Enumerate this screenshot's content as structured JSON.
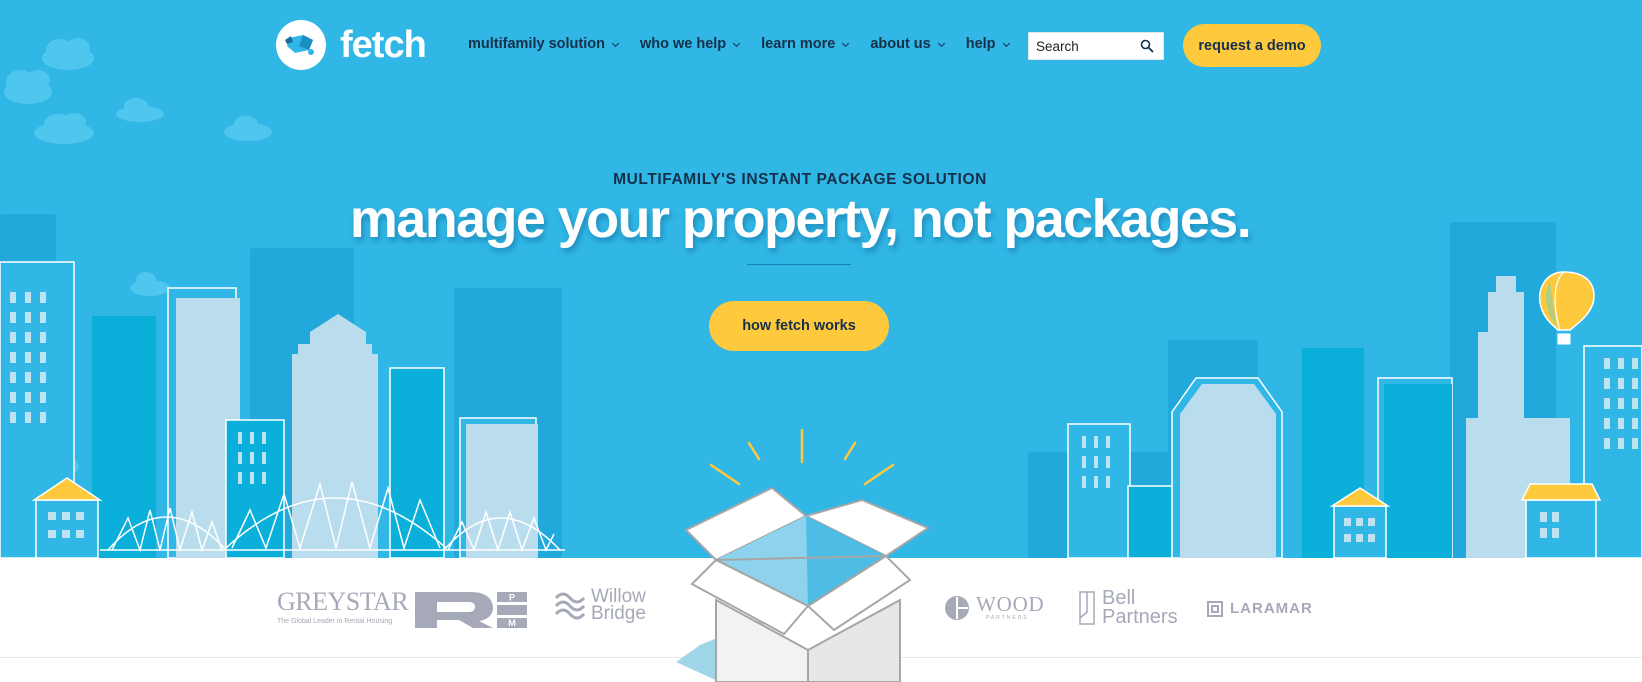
{
  "brand": {
    "name": "fetch",
    "logo_icon": "dog-package-icon"
  },
  "nav": {
    "items": [
      {
        "label": "multifamily solution"
      },
      {
        "label": "who we help"
      },
      {
        "label": "learn more"
      },
      {
        "label": "about us"
      },
      {
        "label": "help"
      }
    ]
  },
  "search": {
    "placeholder": "Search",
    "icon": "search-icon"
  },
  "header": {
    "demo_label": "request a demo"
  },
  "hero": {
    "eyebrow": "MULTIFAMILY'S INSTANT PACKAGE SOLUTION",
    "headline": "manage your property, not packages.",
    "cta_label": "how fetch works"
  },
  "partners": {
    "greystar": {
      "name": "GREYSTAR",
      "tagline": "The Global Leader in Rental Housing"
    },
    "rpm": {
      "name": "RPM"
    },
    "willow": {
      "line1": "Willow",
      "line2": "Bridge"
    },
    "wood": {
      "name": "WOOD",
      "sub": "PARTNERS"
    },
    "bell": {
      "line1": "Bell",
      "line2": "Partners"
    },
    "laramar": {
      "name": "LARAMAR"
    }
  },
  "colors": {
    "sky": "#30b7e6",
    "accent_yellow": "#ffc93e",
    "navy_text": "#16304a",
    "partner_gray": "#a6a9b8"
  }
}
